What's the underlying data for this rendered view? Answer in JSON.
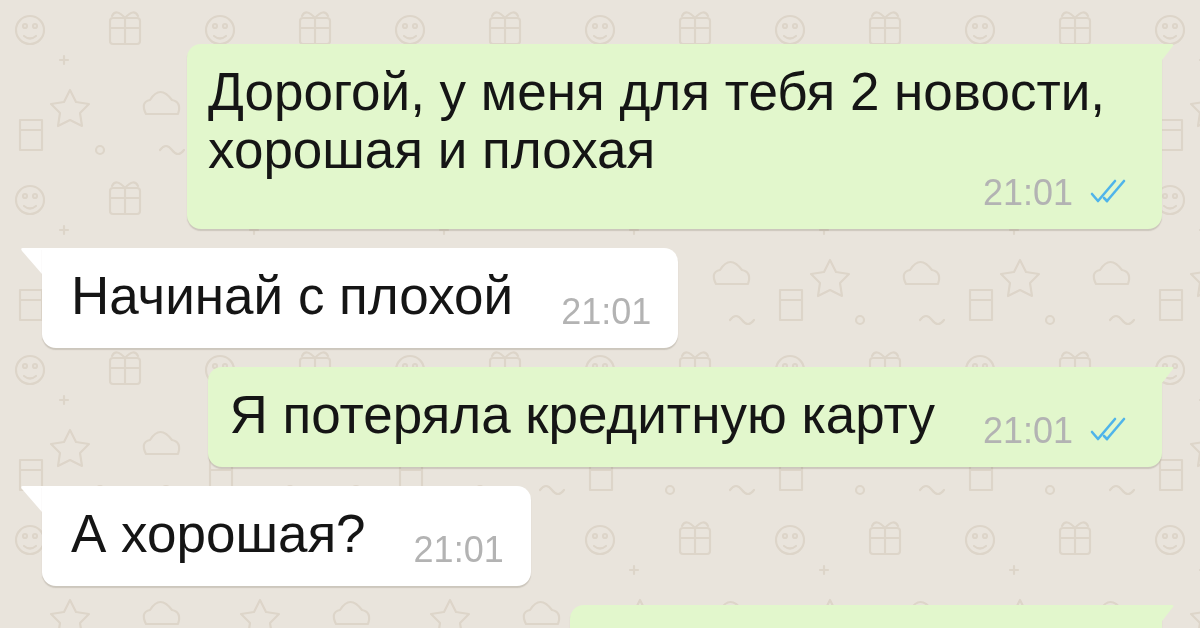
{
  "messages": [
    {
      "kind": "outgoing",
      "text": "Дорогой, у меня для тебя 2 новости, хорошая и плохая",
      "time": "21:01",
      "read": true
    },
    {
      "kind": "incoming",
      "text": "Начинай с плохой",
      "time": "21:01"
    },
    {
      "kind": "outgoing",
      "text": "Я потеряла кредитную карту",
      "time": "21:01",
      "read": true
    },
    {
      "kind": "incoming",
      "text": "А хорошая?",
      "time": "21:01"
    },
    {
      "kind": "outgoing"
    }
  ]
}
